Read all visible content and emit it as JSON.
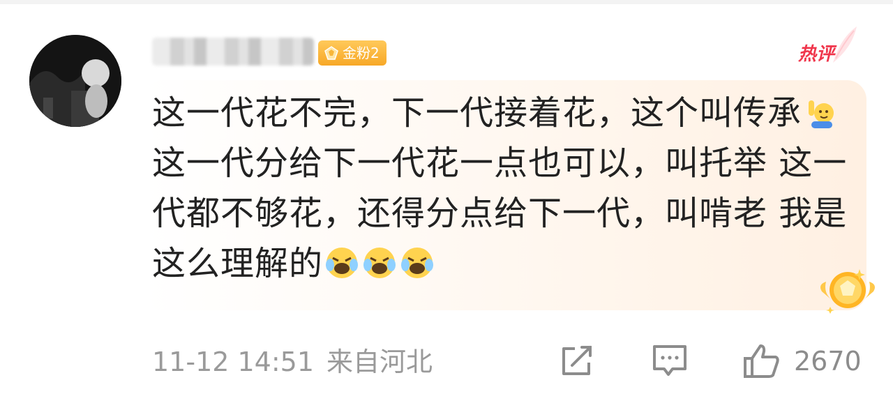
{
  "user": {
    "name": "",
    "fan_badge": "金粉2",
    "avatar_icon": "avatar-photo"
  },
  "hot_tag": "热评",
  "comment": {
    "segments": [
      {
        "type": "text",
        "value": "这一代花不完，下一代接着花，这个叫传承"
      },
      {
        "type": "emoji",
        "name": "raise-hand-emoji"
      },
      {
        "type": "text",
        "value": " 这一代分给下一代花一点也可以，叫托举 这一代都不够花，还得分点给下一代，叫啃老 我是这么理解的"
      },
      {
        "type": "emoji",
        "name": "laugh-cry-emoji"
      },
      {
        "type": "emoji",
        "name": "laugh-cry-emoji"
      },
      {
        "type": "emoji",
        "name": "laugh-cry-emoji"
      }
    ]
  },
  "footer": {
    "time": "11-12 14:51",
    "location": "来自河北"
  },
  "actions": {
    "share_icon": "share-icon",
    "comment_icon": "comment-icon",
    "like_icon": "thumbs-up-icon",
    "like_count": "2670"
  },
  "colors": {
    "accent_red": "#f0364c",
    "badge_gold": "#f7a827",
    "meta_gray": "#9a9a9a"
  }
}
